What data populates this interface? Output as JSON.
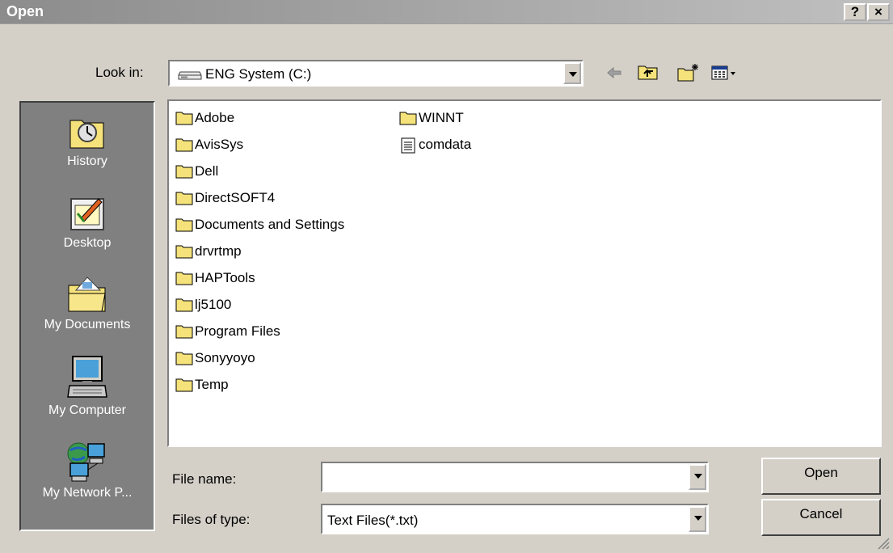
{
  "window": {
    "title": "Open",
    "help_label": "?",
    "close_label": "×"
  },
  "lookin": {
    "label": "Look in:",
    "value": "ENG System (C:)"
  },
  "toolbar": {
    "icons": [
      "back-arrow-icon",
      "up-one-level-icon",
      "new-folder-icon",
      "view-menu-icon"
    ]
  },
  "places": [
    {
      "name": "History",
      "icon": "history-icon"
    },
    {
      "name": "Desktop",
      "icon": "desktop-icon"
    },
    {
      "name": "My Documents",
      "icon": "my-documents-icon"
    },
    {
      "name": "My Computer",
      "icon": "my-computer-icon"
    },
    {
      "name": "My Network P...",
      "icon": "network-places-icon"
    }
  ],
  "files": [
    {
      "name": "Adobe",
      "type": "folder"
    },
    {
      "name": "AvisSys",
      "type": "folder"
    },
    {
      "name": "Dell",
      "type": "folder"
    },
    {
      "name": "DirectSOFT4",
      "type": "folder"
    },
    {
      "name": "Documents and Settings",
      "type": "folder"
    },
    {
      "name": "drvrtmp",
      "type": "folder"
    },
    {
      "name": "HAPTools",
      "type": "folder"
    },
    {
      "name": "lj5100",
      "type": "folder"
    },
    {
      "name": "Program Files",
      "type": "folder"
    },
    {
      "name": "Sonyyoyo",
      "type": "folder"
    },
    {
      "name": "Temp",
      "type": "folder"
    },
    {
      "name": "WINNT",
      "type": "folder"
    },
    {
      "name": "comdata",
      "type": "text"
    }
  ],
  "filename": {
    "label": "File name:",
    "value": ""
  },
  "filetype": {
    "label": "Files of type:",
    "value": "Text Files(*.txt)"
  },
  "buttons": {
    "open": "Open",
    "cancel": "Cancel"
  },
  "colors": {
    "folder": "#f5e27a",
    "titlebar": "#8c8c8c",
    "places_bg": "#808080"
  }
}
